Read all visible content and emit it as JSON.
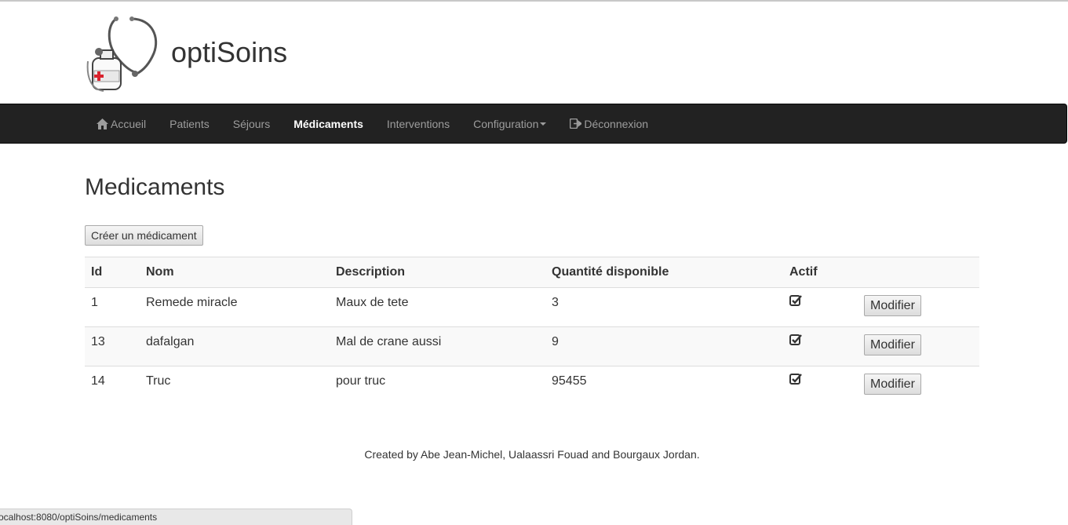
{
  "brand": {
    "title": "optiSoins"
  },
  "nav": {
    "items": [
      {
        "label": "Accueil",
        "icon": "home-icon",
        "active": false
      },
      {
        "label": "Patients",
        "active": false
      },
      {
        "label": "Séjours",
        "active": false
      },
      {
        "label": "Médicaments",
        "active": true
      },
      {
        "label": "Interventions",
        "active": false
      },
      {
        "label": "Configuration",
        "dropdown": true,
        "active": false
      },
      {
        "label": "Déconnexion",
        "icon": "logout-icon",
        "active": false
      }
    ]
  },
  "page": {
    "title": "Medicaments",
    "create_button": "Créer un médicament"
  },
  "table": {
    "headers": [
      "Id",
      "Nom",
      "Description",
      "Quantité disponible",
      "Actif",
      ""
    ],
    "rows": [
      {
        "id": "1",
        "nom": "Remede miracle",
        "description": "Maux de tete",
        "quantite": "3",
        "actif": true,
        "action": "Modifier"
      },
      {
        "id": "13",
        "nom": "dafalgan",
        "description": "Mal de crane aussi",
        "quantite": "9",
        "actif": true,
        "action": "Modifier"
      },
      {
        "id": "14",
        "nom": "Truc",
        "description": "pour truc",
        "quantite": "95455",
        "actif": true,
        "action": "Modifier"
      }
    ]
  },
  "footer": {
    "text": "Created by Abe Jean-Michel, Ualaassri Fouad and Bourgaux Jordan."
  },
  "statusbar": {
    "url": "ocalhost:8080/optiSoins/medicaments"
  },
  "colors": {
    "navbar": "#222222",
    "nav_text": "#9d9d9d",
    "nav_active": "#ffffff",
    "stripe": "#f9f9f9",
    "logo_cross": "#d9232e"
  }
}
